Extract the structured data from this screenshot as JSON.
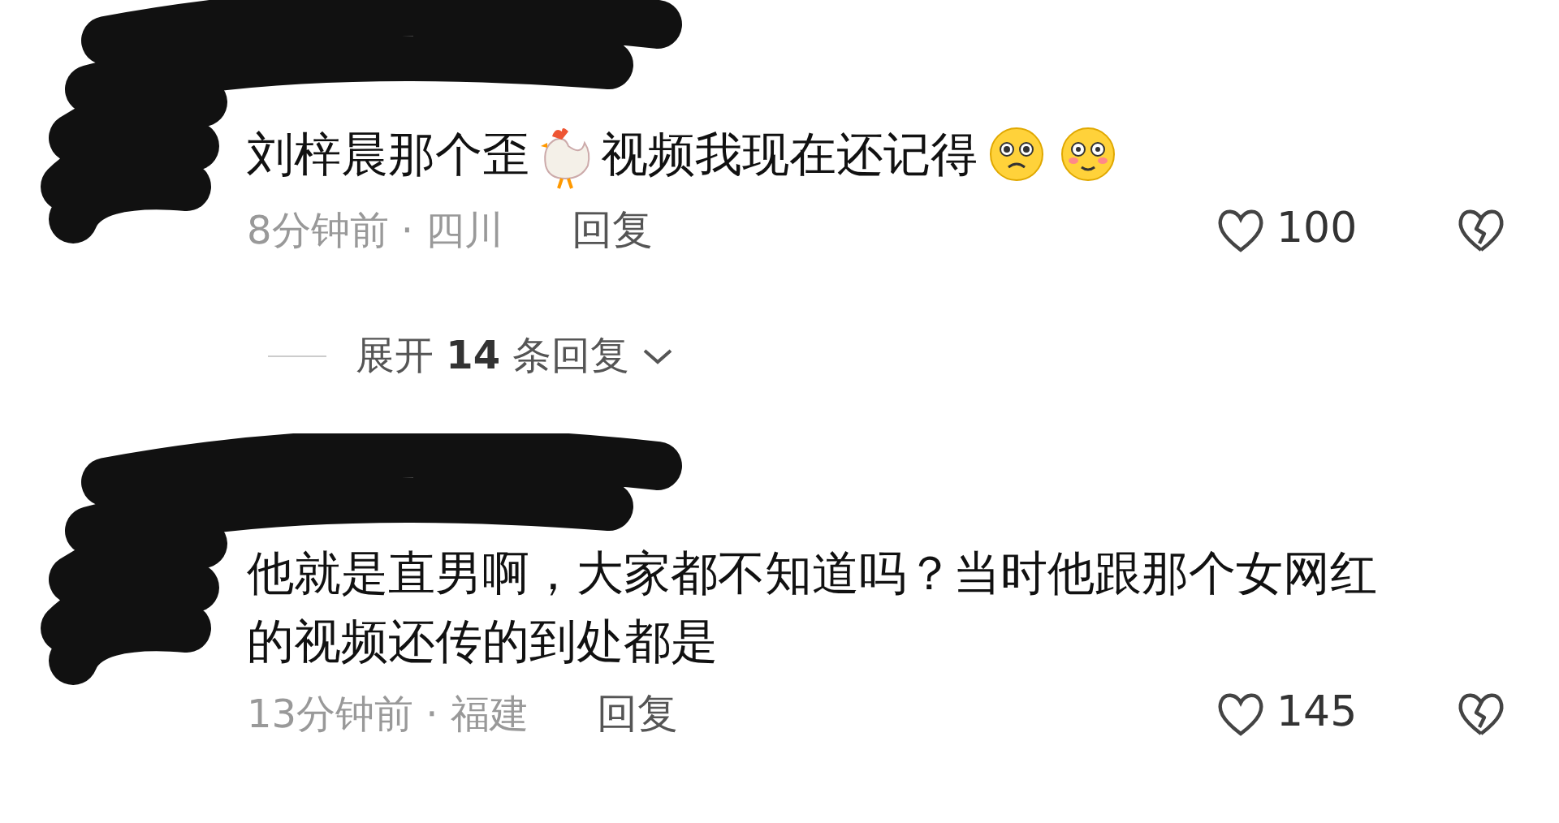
{
  "comments": [
    {
      "text_parts": [
        "刘梓晨那个歪",
        "视频我现在还记得"
      ],
      "time": "8分钟前",
      "sep": "·",
      "location": "四川",
      "reply": "回复",
      "likes": "100",
      "expand": {
        "prefix": "展开",
        "count": "14",
        "suffix": "条回复"
      }
    },
    {
      "text_parts": [
        "他就是直男啊，大家都不知道吗？当时他跟那个女网红的视频还传的到处都是"
      ],
      "time": "13分钟前",
      "sep": "·",
      "location": "福建",
      "reply": "回复",
      "likes": "145"
    }
  ]
}
